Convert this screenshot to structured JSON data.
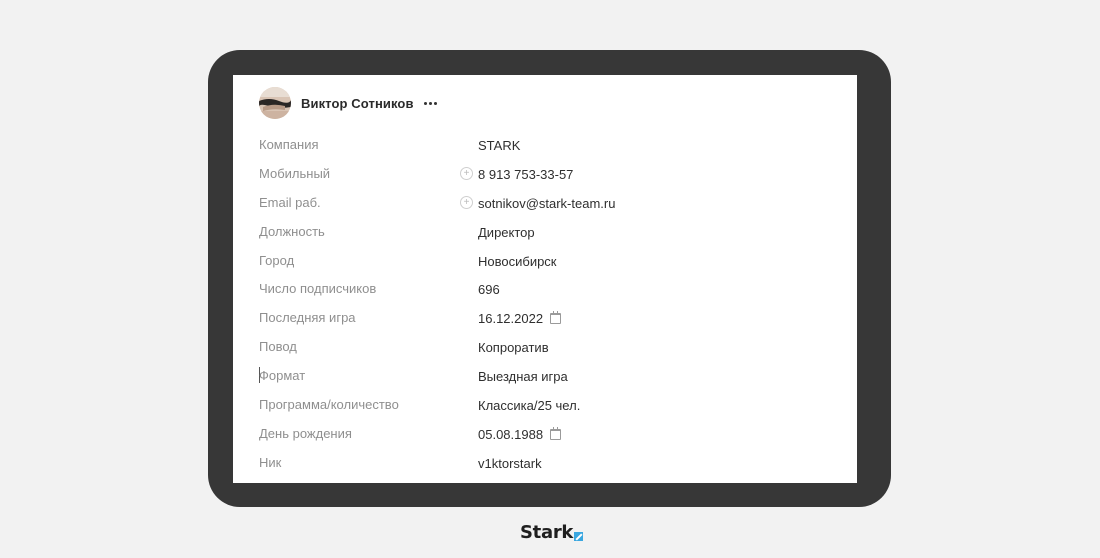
{
  "contact": {
    "name": "Виктор Сотников",
    "more_icon": "ellipsis-icon",
    "avatar_icon": "user-photo"
  },
  "fields": [
    {
      "label": "Компания",
      "value": "STARK"
    },
    {
      "label": "Мобильный",
      "value": "8 913 753-33-57",
      "add_icon": "plus-circle-icon"
    },
    {
      "label": "Email раб.",
      "value": "sotnikov@stark-team.ru",
      "add_icon": "plus-circle-icon"
    },
    {
      "label": "Должность",
      "value": "Директор"
    },
    {
      "label": "Город",
      "value": "Новосибирск"
    },
    {
      "label": "Число подписчиков",
      "value": "696"
    },
    {
      "label": "Последняя игра",
      "value": "16.12.2022",
      "date_icon": "calendar-icon"
    },
    {
      "label": "Повод",
      "value": "Копроратив"
    },
    {
      "label": "Формат",
      "value": "Выездная игра"
    },
    {
      "label": "Программа/количество",
      "value": "Классика/25 чел."
    },
    {
      "label": "День рождения",
      "value": "05.08.1988",
      "date_icon": "calendar-icon"
    },
    {
      "label": "Ник",
      "value": "v1ktorstark"
    }
  ],
  "brand": {
    "logo_text": "Stark",
    "accent_color": "#3aa7e0",
    "frame_color": "#373737"
  }
}
